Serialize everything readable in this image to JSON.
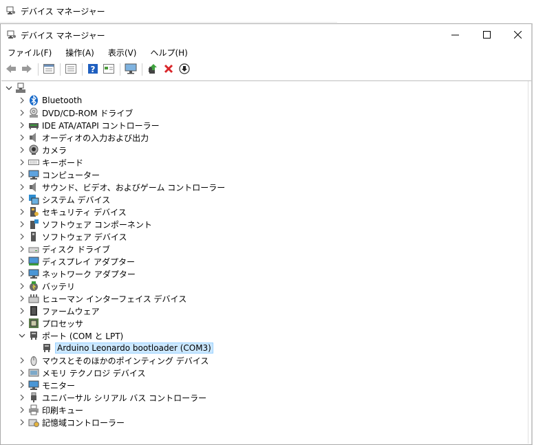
{
  "background_window": {
    "title": "デバイス マネージャー"
  },
  "window": {
    "title": "デバイス マネージャー",
    "controls": {
      "minimize": "─",
      "maximize": "☐",
      "close": "✕"
    }
  },
  "menu": [
    "ファイル(F)",
    "操作(A)",
    "表示(V)",
    "ヘルプ(H)"
  ],
  "toolbar": [
    {
      "name": "back-icon"
    },
    {
      "name": "forward-icon"
    },
    {
      "sep": true
    },
    {
      "name": "properties-icon"
    },
    {
      "sep": true
    },
    {
      "name": "details-icon"
    },
    {
      "sep": true
    },
    {
      "name": "help-icon"
    },
    {
      "name": "view-icon"
    },
    {
      "sep": true
    },
    {
      "name": "monitor-icon"
    },
    {
      "sep": true
    },
    {
      "name": "update-driver-icon"
    },
    {
      "name": "uninstall-icon"
    },
    {
      "name": "scan-icon"
    }
  ],
  "tree": {
    "root_label": "",
    "items": [
      {
        "label": "Bluetooth",
        "icon": "bluetooth-icon",
        "expanded": false
      },
      {
        "label": "DVD/CD-ROM ドライブ",
        "icon": "dvd-icon",
        "expanded": false
      },
      {
        "label": "IDE ATA/ATAPI コントローラー",
        "icon": "ide-icon",
        "expanded": false
      },
      {
        "label": "オーディオの入力および出力",
        "icon": "speaker-icon",
        "expanded": false
      },
      {
        "label": "カメラ",
        "icon": "camera-icon",
        "expanded": false
      },
      {
        "label": "キーボード",
        "icon": "keyboard-icon",
        "expanded": false
      },
      {
        "label": "コンピューター",
        "icon": "computer-icon",
        "expanded": false
      },
      {
        "label": "サウンド、ビデオ、およびゲーム コントローラー",
        "icon": "speaker-icon",
        "expanded": false
      },
      {
        "label": "システム デバイス",
        "icon": "system-icon",
        "expanded": false
      },
      {
        "label": "セキュリティ デバイス",
        "icon": "security-icon",
        "expanded": false
      },
      {
        "label": "ソフトウェア コンポーネント",
        "icon": "software-component-icon",
        "expanded": false
      },
      {
        "label": "ソフトウェア デバイス",
        "icon": "software-device-icon",
        "expanded": false
      },
      {
        "label": "ディスク ドライブ",
        "icon": "disk-icon",
        "expanded": false
      },
      {
        "label": "ディスプレイ アダプター",
        "icon": "display-icon",
        "expanded": false
      },
      {
        "label": "ネットワーク アダプター",
        "icon": "network-icon",
        "expanded": false
      },
      {
        "label": "バッテリ",
        "icon": "battery-icon",
        "expanded": false
      },
      {
        "label": "ヒューマン インターフェイス デバイス",
        "icon": "hid-icon",
        "expanded": false
      },
      {
        "label": "ファームウェア",
        "icon": "firmware-icon",
        "expanded": false
      },
      {
        "label": "プロセッサ",
        "icon": "processor-icon",
        "expanded": false
      },
      {
        "label": "ポート (COM と LPT)",
        "icon": "port-icon",
        "expanded": true,
        "children": [
          {
            "label": "Arduino Leonardo bootloader (COM3)",
            "icon": "port-icon",
            "selected": true
          }
        ]
      },
      {
        "label": "マウスとそのほかのポインティング デバイス",
        "icon": "mouse-icon",
        "expanded": false
      },
      {
        "label": "メモリ テクノロジ デバイス",
        "icon": "memory-icon",
        "expanded": false
      },
      {
        "label": "モニター",
        "icon": "monitor-icon",
        "expanded": false
      },
      {
        "label": "ユニバーサル シリアル バス コントローラー",
        "icon": "usb-icon",
        "expanded": false
      },
      {
        "label": "印刷キュー",
        "icon": "printer-icon",
        "expanded": false
      },
      {
        "label": "記憶域コントローラー",
        "icon": "storage-icon",
        "expanded": false
      }
    ]
  }
}
